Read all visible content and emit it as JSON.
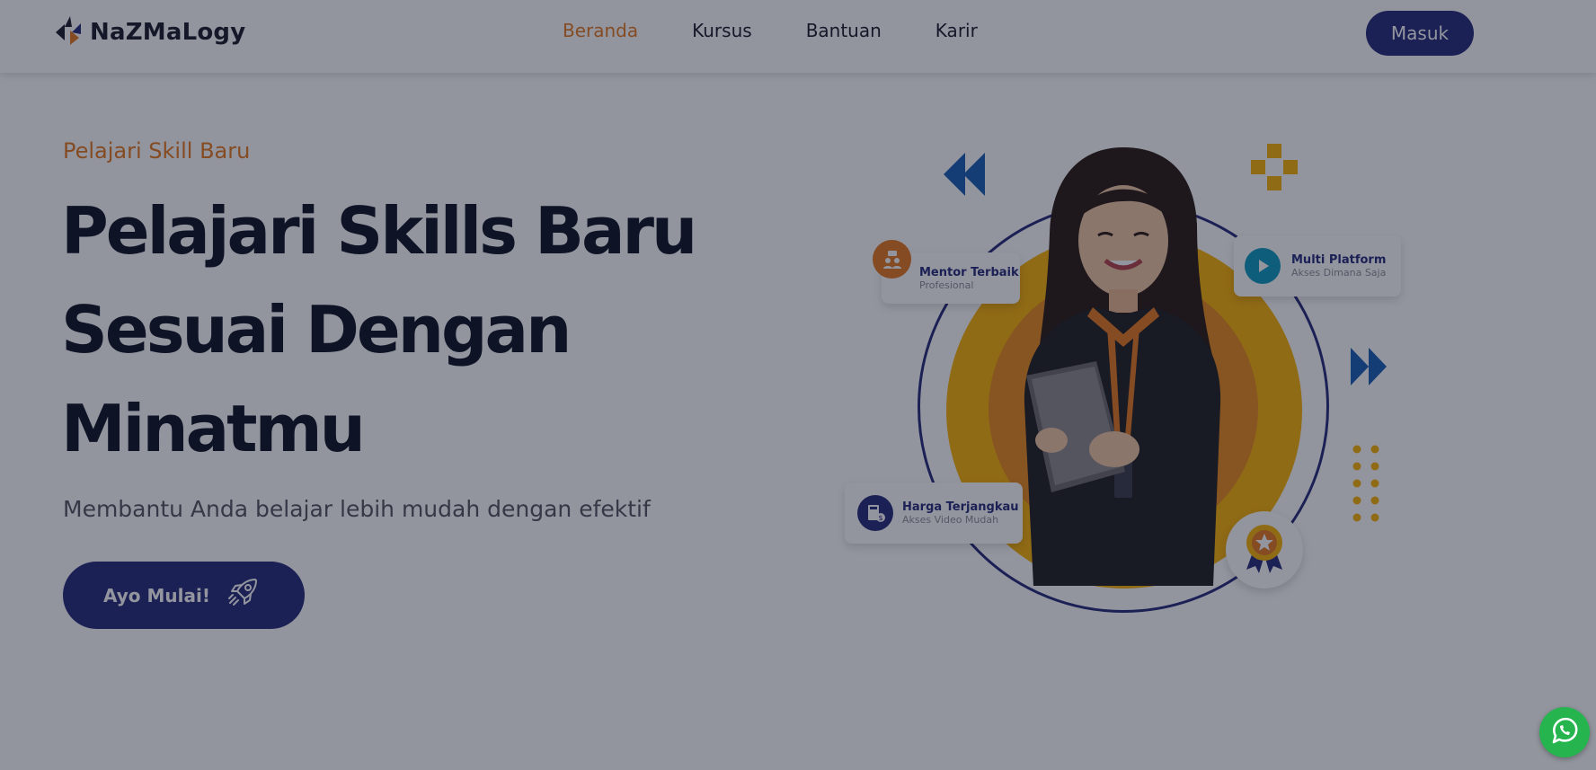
{
  "brand": {
    "name": "NaZMaLogy",
    "logo_icon": "nazmalogy-logo-icon"
  },
  "nav": {
    "items": [
      {
        "label": "Beranda",
        "active": true
      },
      {
        "label": "Kursus",
        "active": false
      },
      {
        "label": "Bantuan",
        "active": false
      },
      {
        "label": "Karir",
        "active": false
      }
    ],
    "login_label": "Masuk"
  },
  "hero": {
    "eyebrow": "Pelajari Skill Baru",
    "title_lines": [
      "Pelajari Skills Baru",
      "Sesuai Dengan",
      "Minatmu"
    ],
    "subtitle": "Membantu Anda belajar lebih mudah dengan efektif",
    "cta_label": "Ayo Mulai!",
    "cta_icon": "rocket-icon"
  },
  "features": {
    "mentor": {
      "title": "Mentor Terbaik",
      "subtitle": "Profesional",
      "icon": "mentor-icon"
    },
    "multi": {
      "title": "Multi Platform",
      "subtitle": "Akses Dimana Saja",
      "icon": "play-icon"
    },
    "harga": {
      "title": "Harga Terjangkau",
      "subtitle": "Akses Video Mudah",
      "icon": "calculator-icon"
    },
    "badge_icon": "award-ribbon-icon"
  },
  "floating": {
    "whatsapp_icon": "whatsapp-icon"
  },
  "colors": {
    "primary": "#262a7a",
    "accent": "#e5781f",
    "yellow": "#f9b208",
    "teal": "#0e9bbf",
    "whatsapp": "#25b44e",
    "overlay": "rgba(15, 20, 40, 0.45)"
  }
}
